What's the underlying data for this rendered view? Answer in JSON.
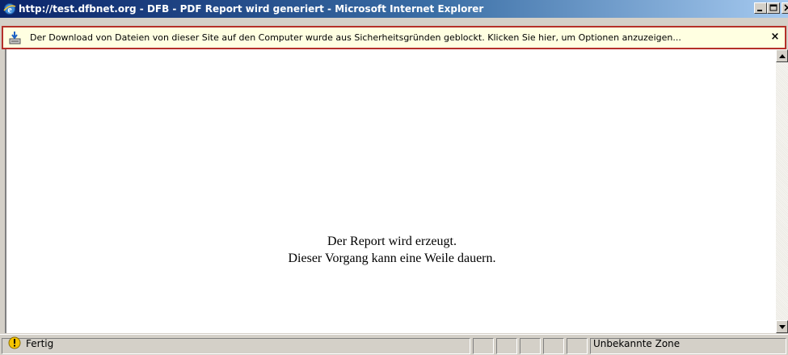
{
  "window": {
    "title": "http://test.dfbnet.org - DFB - PDF Report wird generiert - Microsoft Internet Explorer",
    "icon": "ie-icon"
  },
  "caption_buttons": {
    "minimize_icon": "minimize-icon",
    "maximize_icon": "maximize-icon",
    "close_icon": "close-icon"
  },
  "infobar": {
    "text": "Der Download von Dateien von dieser Site auf den Computer wurde aus Sicherheitsgründen geblockt. Klicken Sie hier, um Optionen anzuzeigen...",
    "close_glyph": "×",
    "icon": "download-blocked-icon",
    "border_color": "#b5302a",
    "background": "#ffffe1"
  },
  "content": {
    "line1": "Der Report wird erzeugt.",
    "line2": "Dieser Vorgang kann eine Weile dauern."
  },
  "statusbar": {
    "status": "Fertig",
    "status_icon": "warning-shield-icon",
    "zone": "Unbekannte Zone"
  },
  "colors": {
    "titlebar_start": "#0a246a",
    "titlebar_end": "#a6caf0",
    "chrome": "#d4d0c8"
  }
}
